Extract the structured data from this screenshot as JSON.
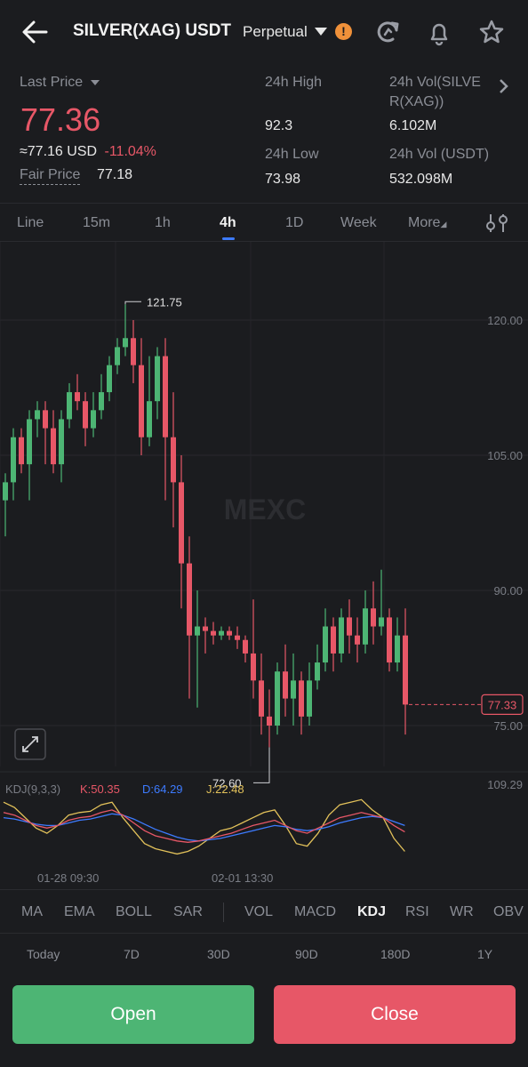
{
  "header": {
    "symbol": "SILVER(XAG) USDT",
    "contract_type": "Perpetual",
    "icons": [
      "back-arrow-icon",
      "refresh-icon",
      "bell-icon",
      "star-icon"
    ]
  },
  "stats": {
    "last_price_label": "Last Price",
    "last_price": "77.36",
    "usd_equiv": "≈77.16 USD",
    "change": "-11.04%",
    "fair_price_label": "Fair Price",
    "fair_price": "77.18",
    "high_label": "24h High",
    "high": "92.3",
    "low_label": "24h Low",
    "low": "73.98",
    "vol_base_label_1": "24h Vol(SILVE",
    "vol_base_label_2": "R(XAG))",
    "vol_base": "6.102M",
    "vol_quote_label": "24h Vol (USDT)",
    "vol_quote": "532.098M"
  },
  "tabs": [
    "Line",
    "15m",
    "1h",
    "4h",
    "1D",
    "Week",
    "More"
  ],
  "active_tab": "4h",
  "chart_labels": {
    "y_ticks": [
      "120.00",
      "105.00",
      "90.00",
      "75.00"
    ],
    "max_marker": "121.75",
    "min_marker": "72.60",
    "current_price_tag": "77.33",
    "watermark": "MEXC",
    "kdj_label": "KDJ(9,3,3)",
    "kdj_k": "K:50.35",
    "kdj_d": "D:64.29",
    "kdj_j": "J:22.48",
    "kdj_top": "109.29",
    "time_1": "01-28 09:30",
    "time_2": "02-01 13:30"
  },
  "chart_data": {
    "type": "candlestick",
    "ylim": [
      72,
      124
    ],
    "candles": [
      [
        100,
        102,
        96,
        103
      ],
      [
        102,
        107,
        100,
        108
      ],
      [
        107,
        104,
        103,
        108
      ],
      [
        104,
        109,
        100,
        110
      ],
      [
        109,
        110,
        107,
        111
      ],
      [
        110,
        108,
        104,
        111
      ],
      [
        108,
        104,
        103,
        110
      ],
      [
        104,
        109,
        102,
        110
      ],
      [
        109,
        112,
        108,
        113
      ],
      [
        112,
        111,
        110,
        114
      ],
      [
        111,
        108,
        106,
        112
      ],
      [
        108,
        110,
        107,
        112
      ],
      [
        110,
        112,
        109,
        114
      ],
      [
        112,
        115,
        111,
        116
      ],
      [
        115,
        117,
        114,
        118
      ],
      [
        117,
        118,
        116,
        121.75
      ],
      [
        118,
        115,
        113,
        120
      ],
      [
        115,
        107,
        105,
        118
      ],
      [
        107,
        111,
        106,
        116
      ],
      [
        111,
        116,
        109,
        117
      ],
      [
        116,
        107,
        100,
        118
      ],
      [
        107,
        102,
        97,
        112
      ],
      [
        102,
        93,
        88,
        105
      ],
      [
        93,
        85,
        78,
        96
      ],
      [
        85,
        86,
        77,
        90
      ],
      [
        86,
        85.5,
        83,
        87
      ],
      [
        85.5,
        85,
        84,
        86.5
      ],
      [
        85,
        85.5,
        84.5,
        86
      ],
      [
        85.5,
        85,
        84.5,
        86
      ],
      [
        85,
        84.5,
        83.5,
        86
      ],
      [
        84.5,
        83,
        82,
        85
      ],
      [
        83,
        80,
        78,
        89
      ],
      [
        80,
        76,
        74,
        83
      ],
      [
        76,
        75,
        72.6,
        79
      ],
      [
        75,
        81,
        74,
        82
      ],
      [
        81,
        78,
        76,
        84
      ],
      [
        78,
        80,
        75,
        83
      ],
      [
        80,
        76,
        74,
        81
      ],
      [
        76,
        80,
        75,
        82
      ],
      [
        80,
        82,
        79,
        84
      ],
      [
        82,
        86,
        81,
        88
      ],
      [
        86,
        83,
        81,
        87
      ],
      [
        83,
        87,
        82,
        88
      ],
      [
        87,
        85,
        83,
        89
      ],
      [
        85,
        84,
        82,
        87
      ],
      [
        84,
        88,
        83,
        90
      ],
      [
        88,
        86,
        84,
        91
      ],
      [
        86,
        87,
        85,
        92.3
      ],
      [
        87,
        82,
        81,
        88
      ],
      [
        82,
        85,
        81,
        87
      ],
      [
        85,
        77.33,
        74,
        88
      ]
    ],
    "kdj": {
      "k": [
        70,
        68,
        64,
        60,
        58,
        60,
        64,
        66,
        67,
        70,
        72,
        68,
        62,
        56,
        52,
        50,
        48,
        47,
        48,
        50,
        52,
        54,
        57,
        60,
        62,
        64,
        60,
        56,
        54,
        58,
        62,
        66,
        68,
        70,
        68,
        66,
        60,
        55
      ],
      "d": [
        66,
        65,
        63,
        61,
        60,
        60,
        62,
        64,
        65,
        67,
        69,
        68,
        65,
        61,
        57,
        54,
        51,
        49,
        48,
        49,
        50,
        52,
        54,
        56,
        58,
        60,
        59,
        57,
        56,
        57,
        59,
        62,
        64,
        66,
        67,
        66,
        63,
        60
      ],
      "j": [
        78,
        74,
        66,
        58,
        54,
        60,
        68,
        70,
        71,
        76,
        78,
        66,
        56,
        46,
        42,
        40,
        38,
        40,
        44,
        50,
        56,
        58,
        62,
        66,
        70,
        72,
        60,
        46,
        44,
        54,
        68,
        76,
        78,
        80,
        72,
        66,
        50,
        40
      ]
    }
  },
  "indicators": [
    "MA",
    "EMA",
    "BOLL",
    "SAR",
    "VOL",
    "MACD",
    "KDJ",
    "RSI",
    "WR",
    "OBV"
  ],
  "active_indicator": "KDJ",
  "ranges": [
    "Today",
    "7D",
    "30D",
    "90D",
    "180D",
    "1Y"
  ],
  "actions": {
    "open": "Open",
    "close": "Close"
  },
  "colors": {
    "up": "#4db574",
    "down": "#e75767",
    "accent": "#3d7bff",
    "kdj_k": "#e75767",
    "kdj_d": "#3d7bff",
    "kdj_j": "#e2c15a"
  }
}
